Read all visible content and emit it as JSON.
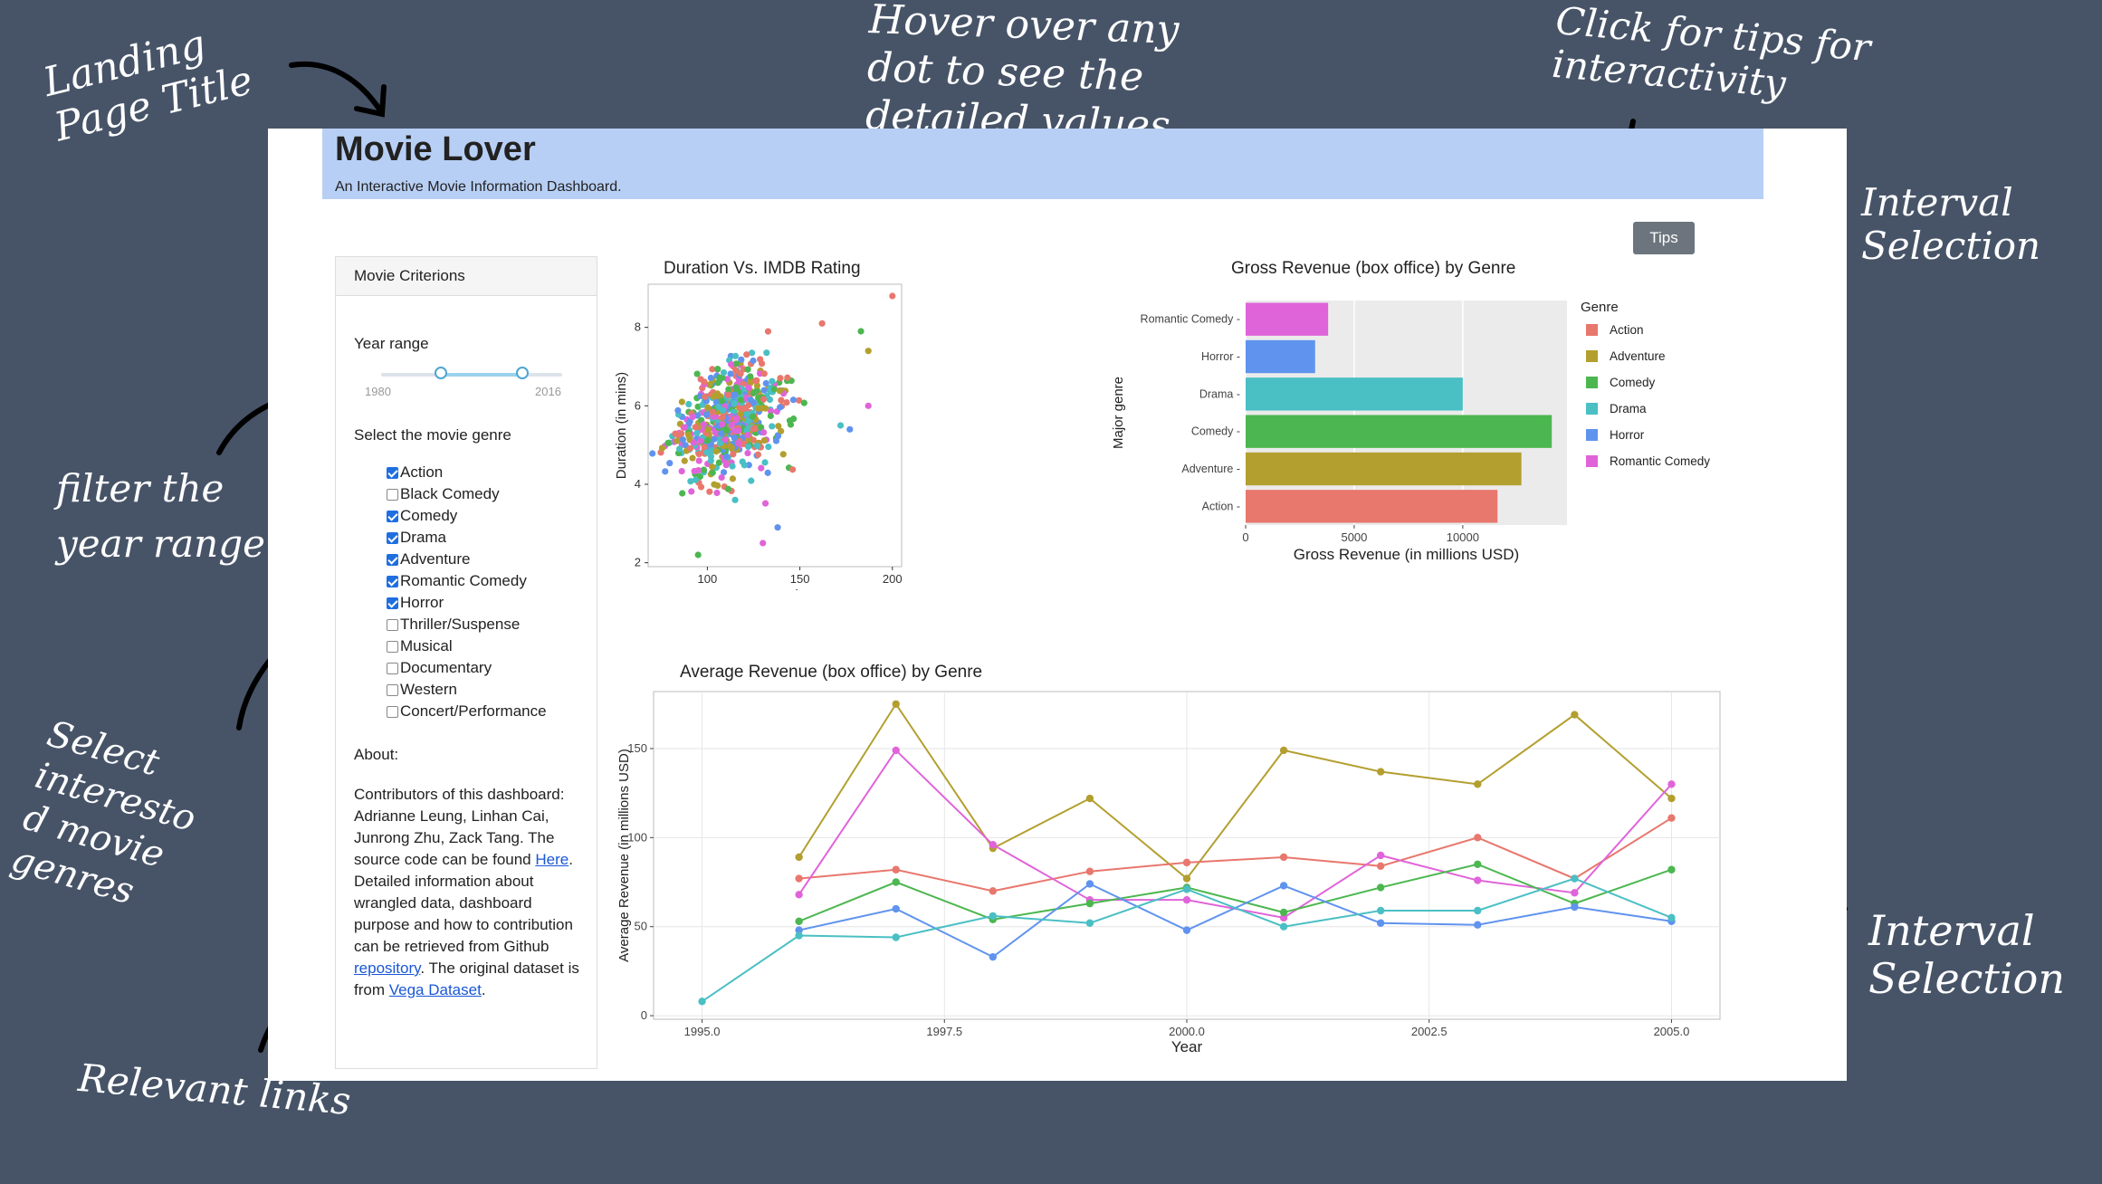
{
  "annotations": {
    "landing_title": "Landing\nPage Title",
    "hover": "Hover over any\ndot to see the\ndetailed values",
    "tips": "Click for tips for\ninteractivity",
    "interval_top": "Interval\nSelection",
    "filter": "filter the\nyear range",
    "select": "Select\ninteresto\nd movie\ngenres",
    "links": "Relevant links",
    "interval_bottom": "Interval\nSelection"
  },
  "header": {
    "title": "Movie Lover",
    "subtitle": "An Interactive Movie Information Dashboard."
  },
  "tips_button": "Tips",
  "sidebar": {
    "heading": "Movie Criterions",
    "year_label": "Year range",
    "year_min": "1980",
    "year_max": "2016",
    "year_range_fraction": [
      0.33,
      0.78
    ],
    "genre_label": "Select the movie genre",
    "genres": [
      {
        "label": "Action",
        "checked": true
      },
      {
        "label": "Black Comedy",
        "checked": false
      },
      {
        "label": "Comedy",
        "checked": true
      },
      {
        "label": "Drama",
        "checked": true
      },
      {
        "label": "Adventure",
        "checked": true
      },
      {
        "label": "Romantic Comedy",
        "checked": true
      },
      {
        "label": "Horror",
        "checked": true
      },
      {
        "label": "Thriller/Suspense",
        "checked": false
      },
      {
        "label": "Musical",
        "checked": false
      },
      {
        "label": "Documentary",
        "checked": false
      },
      {
        "label": "Western",
        "checked": false
      },
      {
        "label": "Concert/Performance",
        "checked": false
      }
    ],
    "about_label": "About:",
    "about": {
      "t1": "Contributors of this dashboard: Adrianne Leung, Linhan Cai, Junrong Zhu, Zack Tang. The source code can be found ",
      "l1": "Here",
      "t2": ". Detailed information about wrangled data, dashboard purpose and how to contribution can be retrieved from Github ",
      "l2": "repository",
      "t3": ". The original dataset is from ",
      "l3": "Vega Dataset",
      "t4": "."
    }
  },
  "colors": {
    "Action": "#e8776d",
    "Adventure": "#b39f2f",
    "Comedy": "#4cb750",
    "Drama": "#4abfc4",
    "Horror": "#5f93ee",
    "Romantic Comedy": "#e064d9"
  },
  "chart_data": [
    {
      "type": "scatter",
      "title": "Duration Vs. IMDB Rating",
      "xlabel": "IMDB Rating",
      "ylabel": "Duration (in mins)",
      "xlim": [
        68,
        205
      ],
      "ylim": [
        1.9,
        9.1
      ],
      "xticks": [
        100,
        150,
        200
      ],
      "yticks": [
        2,
        4,
        6,
        8
      ],
      "series_count": 6,
      "point_count": 620,
      "outliers": [
        {
          "x": 200,
          "y": 8.8
        },
        {
          "x": 187,
          "y": 6.0
        },
        {
          "x": 177,
          "y": 5.4
        },
        {
          "x": 172,
          "y": 5.5
        },
        {
          "x": 183,
          "y": 7.9
        },
        {
          "x": 187,
          "y": 7.4
        },
        {
          "x": 162,
          "y": 8.1
        },
        {
          "x": 130,
          "y": 2.5
        },
        {
          "x": 138,
          "y": 2.9
        },
        {
          "x": 115,
          "y": 3.6
        },
        {
          "x": 95,
          "y": 2.2
        }
      ]
    },
    {
      "type": "bar",
      "orientation": "horizontal",
      "title": "Gross Revenue (box office) by Genre",
      "xlabel": "Gross Revenue (in millions USD)",
      "ylabel": "Major genre",
      "xlim": [
        0,
        14800
      ],
      "xticks": [
        0,
        5000,
        10000
      ],
      "categories": [
        "Romantic Comedy",
        "Horror",
        "Drama",
        "Comedy",
        "Adventure",
        "Action"
      ],
      "values": [
        3800,
        3200,
        10000,
        14100,
        12700,
        11600
      ],
      "legend_title": "Genre",
      "legend": [
        "Action",
        "Adventure",
        "Comedy",
        "Drama",
        "Horror",
        "Romantic Comedy"
      ],
      "legend_position": "right"
    },
    {
      "type": "line",
      "title": "Average Revenue (box office) by Genre",
      "xlabel": "Year",
      "ylabel": "Average Revenue (in millions USD)",
      "xlim": [
        1994.5,
        2005.5
      ],
      "ylim": [
        -2,
        182
      ],
      "xticks": [
        "1995.0",
        "1997.5",
        "2000.0",
        "2002.5",
        "2005.0"
      ],
      "yticks": [
        0,
        50,
        100,
        150
      ],
      "grid": true,
      "series": [
        {
          "name": "Adventure",
          "x": [
            1996,
            1997,
            1998,
            1999,
            2000,
            2001,
            2002,
            2003,
            2004,
            2005
          ],
          "values": [
            89,
            175,
            94,
            122,
            77,
            149,
            137,
            130,
            169,
            122
          ]
        },
        {
          "name": "Action",
          "x": [
            1996,
            1997,
            1998,
            1999,
            2000,
            2001,
            2002,
            2003,
            2004,
            2005
          ],
          "values": [
            77,
            82,
            70,
            81,
            86,
            89,
            84,
            100,
            77,
            111
          ]
        },
        {
          "name": "Romantic Comedy",
          "x": [
            1996,
            1997,
            1998,
            1999,
            2000,
            2001,
            2002,
            2003,
            2004,
            2005
          ],
          "values": [
            68,
            149,
            96,
            65,
            65,
            55,
            90,
            76,
            69,
            130
          ]
        },
        {
          "name": "Comedy",
          "x": [
            1996,
            1997,
            1998,
            1999,
            2000,
            2001,
            2002,
            2003,
            2004,
            2005
          ],
          "values": [
            53,
            75,
            54,
            63,
            72,
            58,
            72,
            85,
            63,
            82
          ]
        },
        {
          "name": "Horror",
          "x": [
            1996,
            1997,
            1998,
            1999,
            2000,
            2001,
            2002,
            2003,
            2004,
            2005
          ],
          "values": [
            48,
            60,
            33,
            74,
            48,
            73,
            52,
            51,
            61,
            53
          ]
        },
        {
          "name": "Drama",
          "x": [
            1995,
            1996,
            1997,
            1998,
            1999,
            2000,
            2001,
            2002,
            2003,
            2004,
            2005
          ],
          "values": [
            8,
            45,
            44,
            56,
            52,
            71,
            50,
            59,
            59,
            77,
            55
          ]
        }
      ]
    }
  ]
}
